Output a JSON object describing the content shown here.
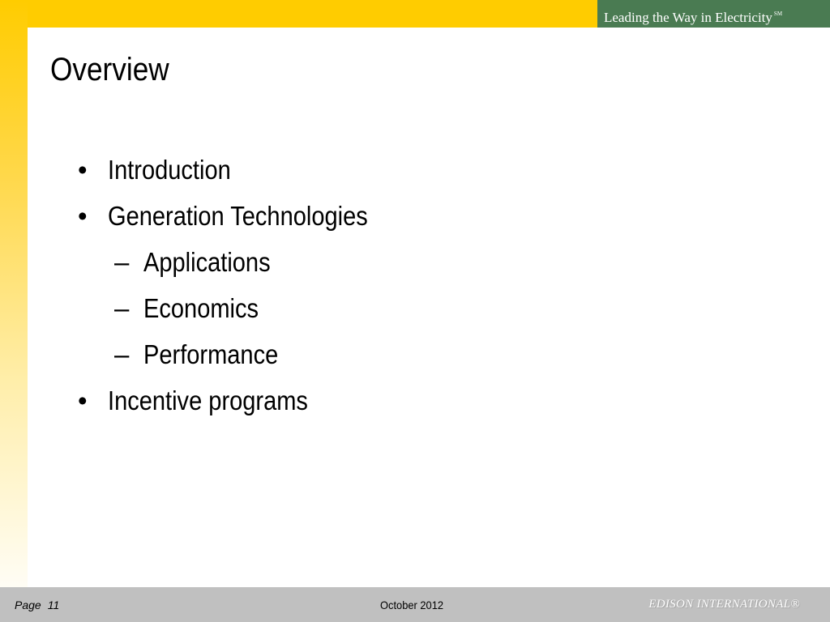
{
  "header": {
    "tagline": "Leading the Way in Electricity",
    "tagline_mark": "SM"
  },
  "slide": {
    "title": "Overview",
    "bullets": [
      {
        "marker": "•",
        "text": "Introduction"
      },
      {
        "marker": "•",
        "text": "Generation Technologies"
      },
      {
        "marker": "–",
        "text": "Applications"
      },
      {
        "marker": "–",
        "text": "Economics"
      },
      {
        "marker": "–",
        "text": "Performance"
      },
      {
        "marker": "•",
        "text": "Incentive programs"
      }
    ]
  },
  "footer": {
    "page_label": "Page",
    "page_number": "11",
    "date": "October 2012",
    "brand": "EDISON INTERNATIONAL®"
  },
  "colors": {
    "accent_yellow": "#ffcc00",
    "tagline_green": "#4a7b52",
    "footer_gray": "#c0c0c0"
  }
}
